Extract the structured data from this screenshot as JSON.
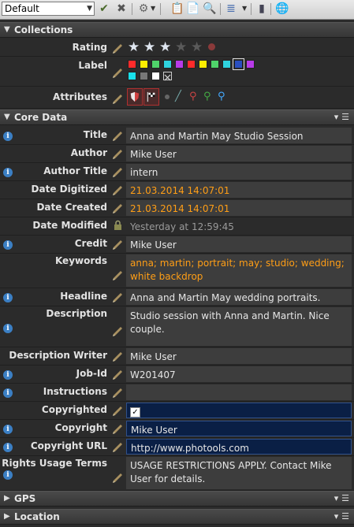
{
  "toolbar": {
    "preset_value": "Default",
    "icons": [
      "checkmark-icon",
      "cross-icon",
      "gear-icon",
      "clipboard-icon",
      "paste-icon",
      "magnifier-icon",
      "list-icon",
      "dock-icon",
      "globe-icon"
    ]
  },
  "collections": {
    "title": "Collections",
    "rating_label": "Rating",
    "rating_value": 3,
    "rating_max": 5,
    "label_label": "Label",
    "label_colors": [
      "#ff2b2b",
      "#ffee00",
      "#4fd36a",
      "#2fd3df",
      "#b83be8",
      "#ff2b2b",
      "#ffee00",
      "#4fd36a",
      "#2fd3df",
      "#2a4fbf",
      "#b83be8",
      "#19e0ea",
      "#777777",
      "#ffffff",
      "none"
    ],
    "attributes_label": "Attributes"
  },
  "core": {
    "title": "Core Data",
    "fields": [
      {
        "label": "Title",
        "value": "Anna and Martin May Studio Session"
      },
      {
        "label": "Author",
        "value": "Mike User"
      },
      {
        "label": "Author Title",
        "value": "intern"
      },
      {
        "label": "Date Digitized",
        "value": "21.03.2014 14:07:01"
      },
      {
        "label": "Date Created",
        "value": "21.03.2014 14:07:01"
      },
      {
        "label": "Date Modified",
        "value": "Yesterday at 12:59:45"
      },
      {
        "label": "Credit",
        "value": "Mike User"
      },
      {
        "label": "Keywords",
        "value": "anna; martin; portrait; may; studio; wedding; white backdrop"
      },
      {
        "label": "Headline",
        "value": "Anna and Martin May wedding portraits."
      },
      {
        "label": "Description",
        "value": "Studio session with Anna and Martin. Nice couple."
      },
      {
        "label": "Description Writer",
        "value": "Mike User"
      },
      {
        "label": "Job-Id",
        "value": "W201407"
      },
      {
        "label": "Instructions",
        "value": ""
      },
      {
        "label": "Copyrighted",
        "value": ""
      },
      {
        "label": "Copyright",
        "value": "Mike User"
      },
      {
        "label": "Copyright URL",
        "value": "http://www.photools.com"
      },
      {
        "label": "Rights Usage Terms",
        "value": "USAGE RESTRICTIONS APPLY. Contact Mike User for details."
      }
    ]
  },
  "gps": {
    "title": "GPS"
  },
  "location": {
    "title": "Location"
  }
}
